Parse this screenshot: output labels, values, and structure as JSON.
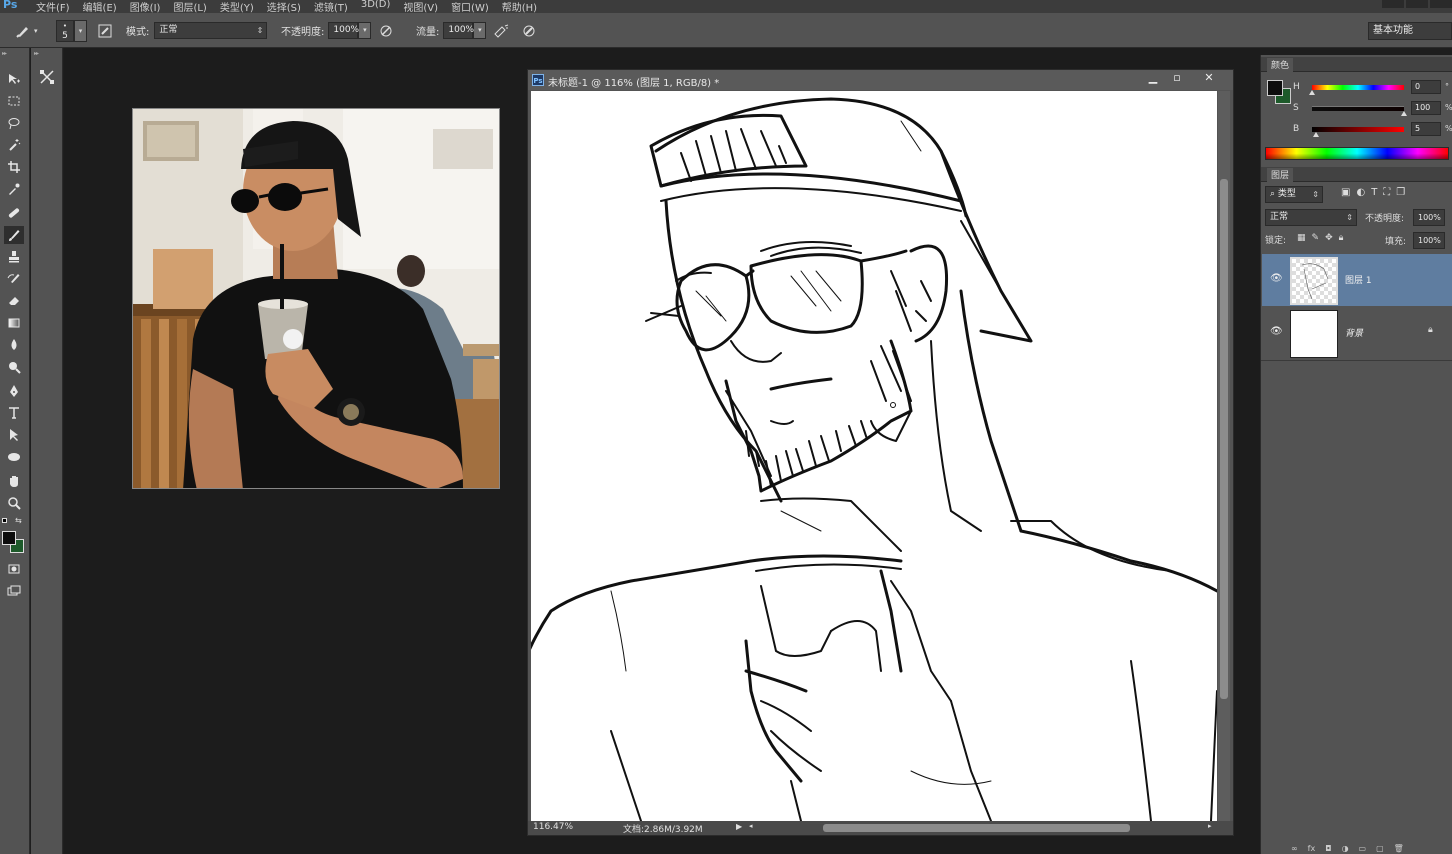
{
  "app": {
    "logo": "Ps"
  },
  "menu": [
    "文件(F)",
    "编辑(E)",
    "图像(I)",
    "图层(L)",
    "类型(Y)",
    "选择(S)",
    "滤镜(T)",
    "3D(D)",
    "视图(V)",
    "窗口(W)",
    "帮助(H)"
  ],
  "options": {
    "brush_size": "5",
    "mode_label": "模式:",
    "mode_value": "正常",
    "opacity_label": "不透明度:",
    "opacity_value": "100%",
    "flow_label": "流量:",
    "flow_value": "100%",
    "workspace": "基本功能"
  },
  "document": {
    "title": "未标题-1 @ 116% (图层 1, RGB/8) *",
    "zoom": "116.47%",
    "doc_size": "文档:2.86M/3.92M"
  },
  "color_panel": {
    "tab": "颜色",
    "h_label": "H",
    "h_value": "0",
    "s_label": "S",
    "s_value": "100",
    "b_label": "B",
    "b_value": "5",
    "foreground_color": "#0d0d0d",
    "background_color": "#1d5a2a"
  },
  "layers_panel": {
    "tab": "图层",
    "filter_kind": "类型",
    "blend_mode": "正常",
    "opacity_label": "不透明度:",
    "opacity_value": "100%",
    "lock_label": "锁定:",
    "fill_label": "填充:",
    "fill_value": "100%",
    "layers": [
      {
        "name": "图层 1",
        "selected": true,
        "locked": false
      },
      {
        "name": "背景",
        "selected": false,
        "locked": true
      }
    ]
  },
  "colors": {
    "selection": "#5f7da0",
    "panel": "#535353",
    "workarea": "#1c1c1c"
  }
}
